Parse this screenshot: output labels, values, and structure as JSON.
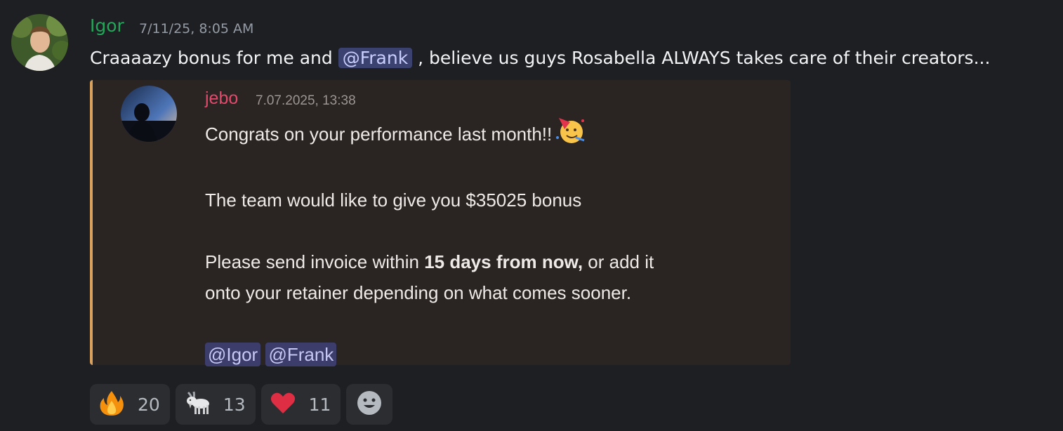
{
  "message": {
    "author": "Igor",
    "timestamp": "7/11/25, 8:05 AM",
    "text_before": "Craaaazy bonus for me and ",
    "mention": "@Frank",
    "text_after": " , believe us guys Rosabella ALWAYS takes care of their creators..."
  },
  "embed": {
    "author": "jebo",
    "timestamp": "7.07.2025, 13:38",
    "line1": "Congrats on your performance last month!!",
    "line2": "The team would like to give you $35025 bonus",
    "line3_before": "Please send invoice within ",
    "line3_bold": "15 days from now,",
    "line3_after": " or add it",
    "line4": "onto your retainer depending on what comes sooner.",
    "mention1": "@Igor",
    "mention2": "@Frank",
    "accent_color": "#d9a15b"
  },
  "reactions": [
    {
      "emoji": "fire-icon",
      "count": "20"
    },
    {
      "emoji": "goat-icon",
      "count": "13"
    },
    {
      "emoji": "heart-icon",
      "count": "11"
    }
  ],
  "colors": {
    "background": "#1e1f22",
    "author_color": "#23a55a",
    "embed_author_color": "#e24a6c",
    "mention_bg": "#3c4270"
  }
}
